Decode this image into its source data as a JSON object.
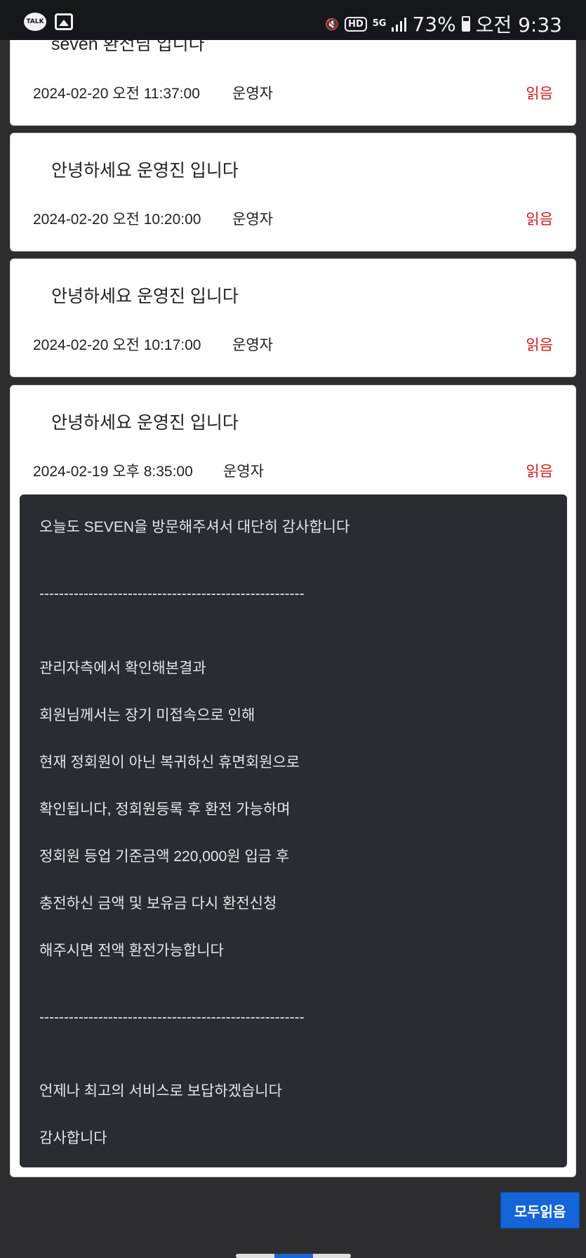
{
  "status_bar": {
    "talk_label": "TALK",
    "hd_label": "HD",
    "network_label": "5G",
    "battery_text": "73%",
    "time_text": "오전 9:33"
  },
  "cards": [
    {
      "title": "seven 환전님 입니다",
      "date": "2024-02-20 오전 11:37:00",
      "author": "운영자",
      "read_label": "읽음"
    },
    {
      "title": "안녕하세요 운영진 입니다",
      "date": "2024-02-20 오전 10:20:00",
      "author": "운영자",
      "read_label": "읽음"
    },
    {
      "title": "안녕하세요 운영진 입니다",
      "date": "2024-02-20 오전 10:17:00",
      "author": "운영자",
      "read_label": "읽음"
    },
    {
      "title": "안녕하세요 운영진 입니다",
      "date": "2024-02-19 오후 8:35:00",
      "author": "운영자",
      "read_label": "읽음"
    }
  ],
  "message": {
    "lines": [
      "오늘도 SEVEN을 방문해주셔서 대단히 감사합니다",
      "------------------------------------------------------",
      "관리자측에서 확인해본결과",
      "회원님께서는 장기 미접속으로 인해",
      "현재 정회원이 아닌 복귀하신 휴면회원으로",
      "확인됩니다, 정회원등록 후 환전 가능하며",
      "정회원 등업 기준금액 220,000원 입금 후",
      "충전하신 금액 및 보유금 다시 환전신청",
      "해주시면 전액 환전가능합니다",
      "------------------------------------------------------",
      "언제나 최고의 서비스로 보답하겠습니다",
      "감사합니다"
    ]
  },
  "read_all_button": "모두읽음"
}
